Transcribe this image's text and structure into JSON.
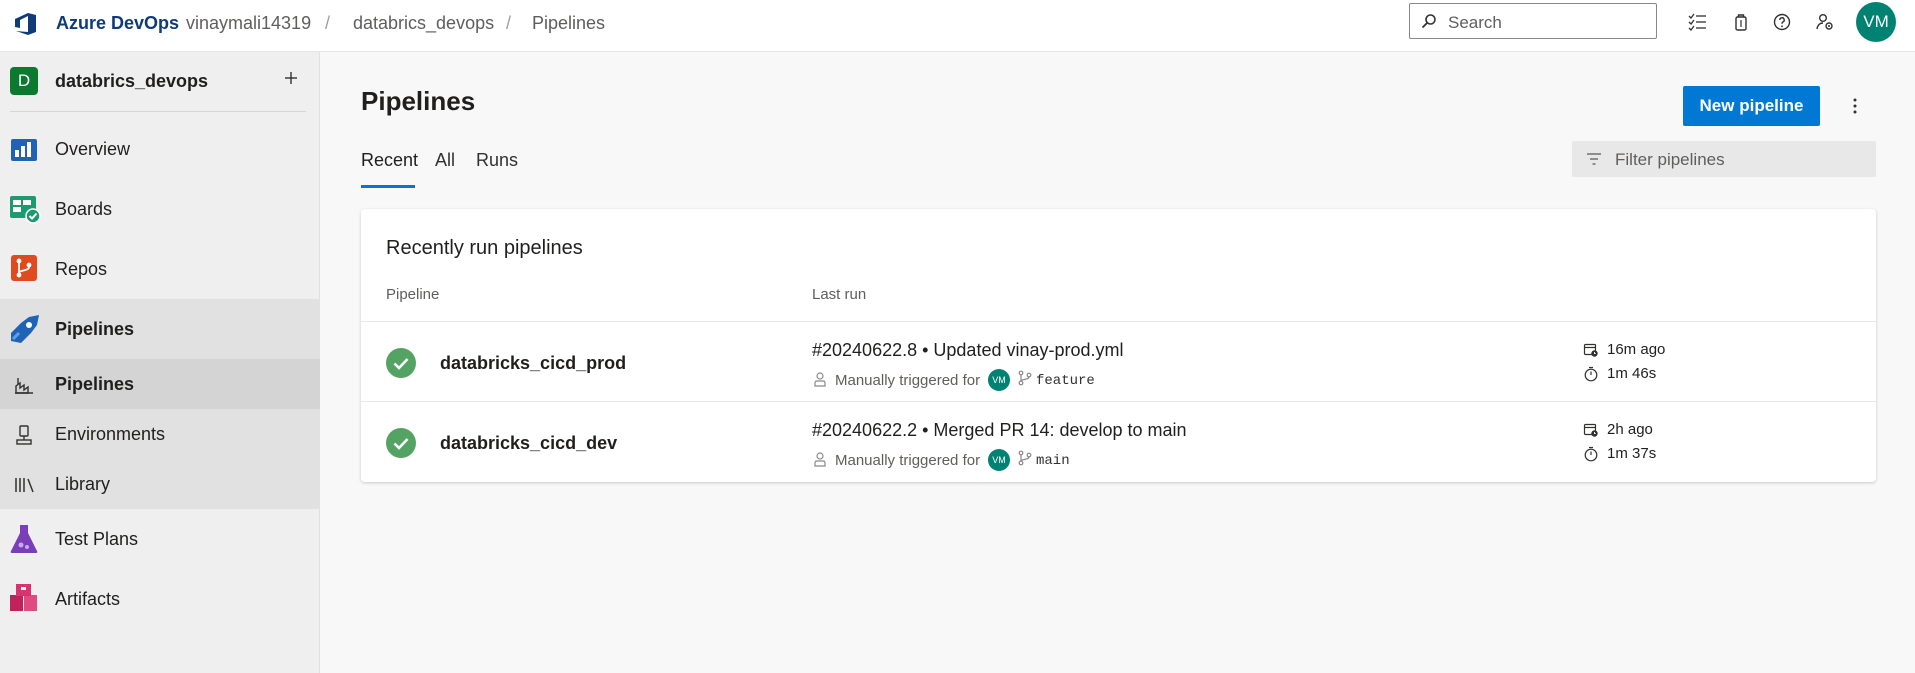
{
  "topbar": {
    "brand": "Azure DevOps",
    "breadcrumb": [
      "vinaymali14319",
      "databrics_devops",
      "Pipelines"
    ],
    "separator": "/",
    "search_placeholder": "Search",
    "user_initials": "VM",
    "icons": [
      "task-list-icon",
      "marketplace-bag-icon",
      "help-icon",
      "user-settings-icon"
    ]
  },
  "project": {
    "initial": "D",
    "name": "databrics_devops"
  },
  "sidebar": {
    "items": [
      {
        "label": "Overview",
        "icon": "overview-icon"
      },
      {
        "label": "Boards",
        "icon": "boards-icon"
      },
      {
        "label": "Repos",
        "icon": "repos-icon"
      },
      {
        "label": "Pipelines",
        "icon": "pipelines-icon"
      },
      {
        "label": "Pipelines",
        "icon": "pipelines-sub-icon"
      },
      {
        "label": "Environments",
        "icon": "environments-icon"
      },
      {
        "label": "Library",
        "icon": "library-icon"
      },
      {
        "label": "Test Plans",
        "icon": "test-plans-icon"
      },
      {
        "label": "Artifacts",
        "icon": "artifacts-icon"
      }
    ]
  },
  "main": {
    "title": "Pipelines",
    "new_button": "New pipeline",
    "tabs": [
      "Recent",
      "All",
      "Runs"
    ],
    "active_tab": "Recent",
    "filter_placeholder": "Filter pipelines",
    "card_title": "Recently run pipelines",
    "columns": [
      "Pipeline",
      "Last run"
    ],
    "rows": [
      {
        "name": "databricks_cicd_prod",
        "status": "succeeded",
        "run_title": "#20240622.8 • Updated vinay-prod.yml",
        "trigger": "Manually triggered for",
        "avatar": "VM",
        "branch": "feature",
        "ago": "16m ago",
        "duration": "1m 46s"
      },
      {
        "name": "databricks_cicd_dev",
        "status": "succeeded",
        "run_title": "#20240622.2 • Merged PR 14: develop to main",
        "trigger": "Manually triggered for",
        "avatar": "VM",
        "branch": "main",
        "ago": "2h ago",
        "duration": "1m 37s"
      }
    ]
  },
  "colors": {
    "accent": "#0078d4",
    "success": "#55a362",
    "avatar": "#008272",
    "project_badge": "#0a7a2f"
  }
}
